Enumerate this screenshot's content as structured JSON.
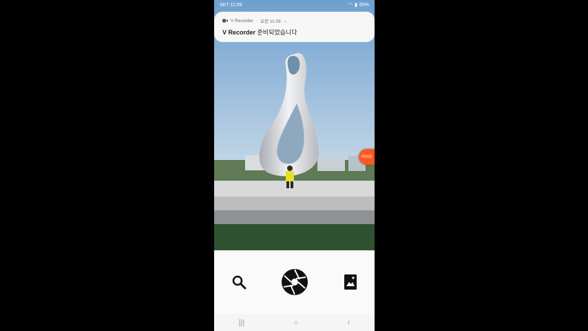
{
  "status_bar": {
    "carrier_time": "SKT 11:09",
    "battery": "65%"
  },
  "notification": {
    "app_name": "V Recorder",
    "time": "오전 11:09",
    "message_bold": "V Recorder",
    "message_rest": " 준비되었습니다"
  },
  "recorder": {
    "timer": "00:03",
    "accent_color": "#ff5722"
  },
  "toolbar": {
    "icons": [
      "search-icon",
      "shutter-icon",
      "gallery-icon"
    ]
  },
  "nav": {
    "recents": "|||",
    "home": "○",
    "back": "‹"
  }
}
